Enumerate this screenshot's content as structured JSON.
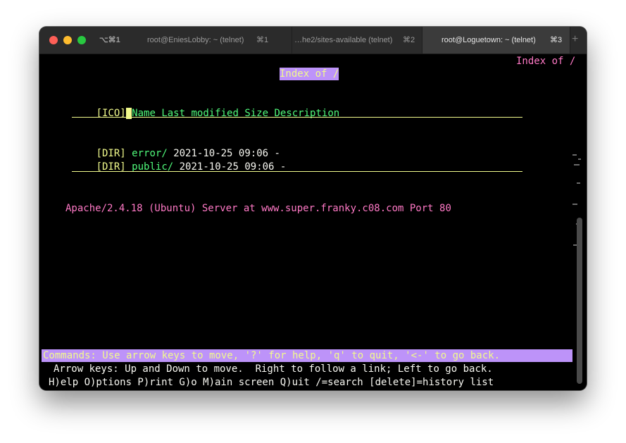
{
  "window": {
    "shortcut_all": "⌥⌘1",
    "tabs": [
      {
        "label": "root@EniesLobby: ~ (telnet)",
        "key": "⌘1",
        "active": false
      },
      {
        "label": "…he2/sites-available (telnet)",
        "key": "⌘2",
        "active": false
      },
      {
        "label": "root@Loguetown: ~ (telnet)",
        "key": "⌘3",
        "active": true
      }
    ],
    "new_tab": "+"
  },
  "terminal": {
    "corner_title": "Index of /",
    "heading": "Index of /",
    "header_ico": "[ICO]",
    "header_cursor": " ",
    "header_cols": "Name Last modified Size Description",
    "rows": [
      {
        "type": "[DIR]",
        "name": "error/",
        "modified": "2021-10-25 09:06",
        "size": "-"
      },
      {
        "type": "[DIR]",
        "name": "public/",
        "modified": "2021-10-25 09:06",
        "size": "-"
      }
    ],
    "server_signature": "Apache/2.4.18 (Ubuntu) Server at www.super.franky.c08.com Port 80",
    "commands_line": "Commands: Use arrow keys to move, '?' for help, 'q' to quit, '<-' to go back.",
    "arrow_keys_line": "Arrow keys: Up and Down to move.  Right to follow a link; Left to go back.",
    "menu_line": "H)elp O)ptions P)rint G)o M)ain screen Q)uit /=search [delete]=history list"
  },
  "colors": {
    "pink": "#ff79c6",
    "green": "#50fa7b",
    "yellow": "#f1fa8c",
    "purple": "#bd93f9"
  }
}
